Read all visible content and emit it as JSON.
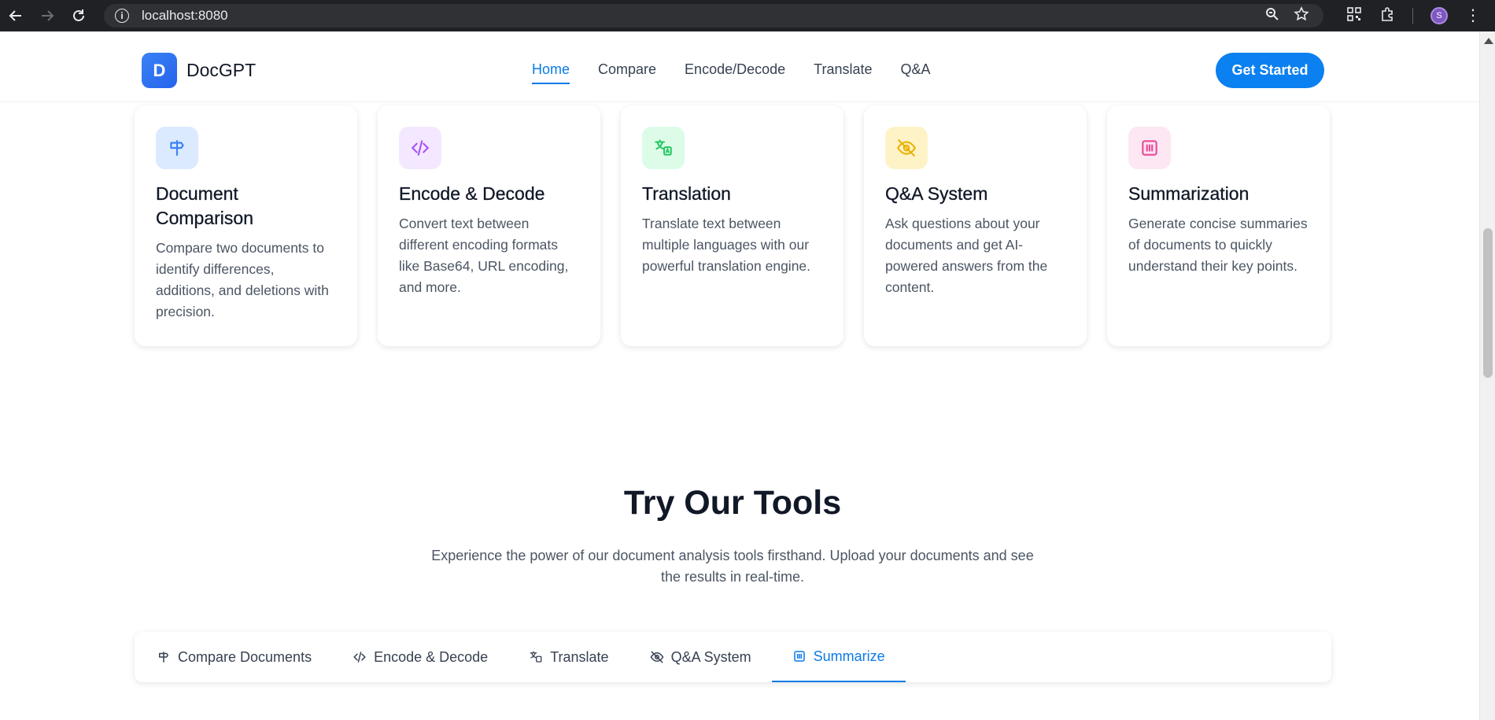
{
  "browser": {
    "url": "localhost:8080",
    "avatar_letter": "S"
  },
  "header": {
    "logo_letter": "D",
    "logo_text": "DocGPT",
    "nav": [
      "Home",
      "Compare",
      "Encode/Decode",
      "Translate",
      "Q&A"
    ],
    "active_nav": "Home",
    "cta_label": "Get Started"
  },
  "features": [
    {
      "title": "Document Comparison",
      "desc": "Compare two documents to identify differences, additions, and deletions with precision.",
      "icon": "signpost-icon",
      "icon_bg": "#dbeafe",
      "icon_color": "#3b82f6"
    },
    {
      "title": "Encode & Decode",
      "desc": "Convert text between different encoding formats like Base64, URL encoding, and more.",
      "icon": "code-icon",
      "icon_bg": "#f3e8ff",
      "icon_color": "#a855f7"
    },
    {
      "title": "Translation",
      "desc": "Translate text between multiple languages with our powerful translation engine.",
      "icon": "translate-icon",
      "icon_bg": "#dcfce7",
      "icon_color": "#22c55e"
    },
    {
      "title": "Q&A System",
      "desc": "Ask questions about your documents and get AI-powered answers from the content.",
      "icon": "eye-off-icon",
      "icon_bg": "#fef3c7",
      "icon_color": "#eab308"
    },
    {
      "title": "Summarization",
      "desc": "Generate concise summaries of documents to quickly understand their key points.",
      "icon": "summary-icon",
      "icon_bg": "#fce7f3",
      "icon_color": "#ec4899"
    }
  ],
  "tools": {
    "title": "Try Our Tools",
    "desc": "Experience the power of our document analysis tools firsthand. Upload your documents and see the results in real-time.",
    "tabs": [
      "Compare Documents",
      "Encode & Decode",
      "Translate",
      "Q&A System",
      "Summarize"
    ],
    "active_tab": "Summarize"
  }
}
